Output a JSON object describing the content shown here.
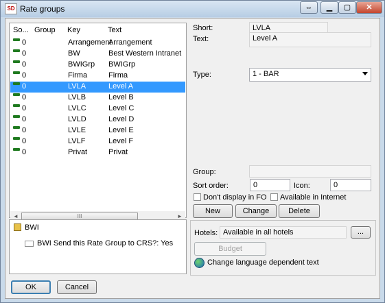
{
  "window": {
    "title": "Rate groups",
    "icon_text": "SD"
  },
  "titlebar_buttons": [
    "⇔",
    "▁",
    "▢",
    "✕"
  ],
  "list": {
    "headers": [
      "So...",
      "Group",
      "Key",
      "Text"
    ],
    "rows": [
      {
        "so": "0",
        "group": "",
        "key": "Arrangement",
        "text": "Arrangement"
      },
      {
        "so": "0",
        "group": "",
        "key": "BW",
        "text": "Best Western Intranet"
      },
      {
        "so": "0",
        "group": "",
        "key": "BWIGrp",
        "text": "BWIGrp"
      },
      {
        "so": "0",
        "group": "",
        "key": "Firma",
        "text": "Firma"
      },
      {
        "so": "0",
        "group": "",
        "key": "LVLA",
        "text": "Level A"
      },
      {
        "so": "0",
        "group": "",
        "key": "LVLB",
        "text": "Level B"
      },
      {
        "so": "0",
        "group": "",
        "key": "LVLC",
        "text": "Level C"
      },
      {
        "so": "0",
        "group": "",
        "key": "LVLD",
        "text": "Level D"
      },
      {
        "so": "0",
        "group": "",
        "key": "LVLE",
        "text": "Level E"
      },
      {
        "so": "0",
        "group": "",
        "key": "LVLF",
        "text": "Level F"
      },
      {
        "so": "0",
        "group": "",
        "key": "Privat",
        "text": "Privat"
      }
    ],
    "scroll_thumb": "III",
    "scroll_left": "◄",
    "scroll_right": "►"
  },
  "bwi": {
    "title": "BWI",
    "option": "BWI Send this Rate Group to CRS?: Yes"
  },
  "details": {
    "short_label": "Short:",
    "short_value": "LVLA",
    "text_label": "Text:",
    "text_value": "Level A",
    "type_label": "Type:",
    "type_value": "1 - BAR",
    "group_label": "Group:",
    "group_value": "",
    "sort_label": "Sort order:",
    "sort_value": "0",
    "icon_label": "Icon:",
    "icon_value": "0",
    "dont_display_label": "Don't display in FO",
    "available_internet_label": "Available in Internet"
  },
  "actions": {
    "new": "New",
    "change": "Change",
    "delete": "Delete"
  },
  "hotels": {
    "label": "Hotels:",
    "value": "Available in all hotels",
    "browse": "...",
    "budget": "Budget",
    "lang_text": "Change language dependent text"
  },
  "footer": {
    "ok": "OK",
    "cancel": "Cancel"
  }
}
